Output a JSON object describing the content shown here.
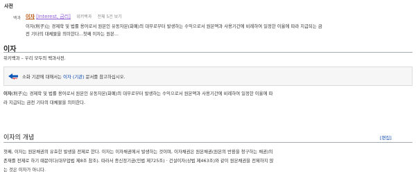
{
  "dictionary_section": {
    "label": "사전",
    "source_label": "백과",
    "result": {
      "term": "이자",
      "subterm": "[Interest, 금리]",
      "source": "위키백과",
      "view_all": "전체 5건 보기",
      "snippet_line1": "이자(利子)는 경제학 및 법률 용어로서 원본인 유동자본(화폐)의 대부로부터 발생하는 수익으로서 원본액과 사용기간에 비례하여 일정한 이율에 따라 지급되는 금",
      "snippet_line2": "전 기타의 대체물을 의미한다...첫째 이자는 원본..."
    }
  },
  "article": {
    "title": "이자",
    "subtitle": "위키백과 – 우리 모두의 백과사전.",
    "notice": {
      "text_before": "소화 기관에 대해서는",
      "link": "이자 (기관)",
      "text_after": "문서를 참고하십시오."
    },
    "intro": {
      "term": "이자",
      "line1": "(利子)는 경제학 및 법률 용어로서 원본인 유동자본(화폐)의 대부로부터 발생하는 수익으로서 원본액과 사용기간에 비례하여 일정한 이율에 따",
      "line2": "라 지급되는 금전 기타의 대체물을 의미한다."
    },
    "section": {
      "heading": "이자의 개념",
      "edit_label": "[편집]",
      "line1": "첫째, 이자는 원본채권의 유효한 발생을 전제로 한다. 이자는 이자채권에서 발생하는 것이며, 이자채권은 원본채권(원본의 반환을 청구하는 채권)의",
      "line2": "존재를 전제로 하기 때문이다(대부업법 제8조 참조). 따라서 종신정기금(민법 제725조) · 건설이자(상법 제463조)와 같이 원본채권을 전제하지 않",
      "line3": "는 것은 이자가 아니다."
    }
  },
  "colors": {
    "link": "#0645ad",
    "term_highlight": "#b54b00",
    "subterm": "#8e5bd6"
  },
  "icons": {
    "notice": "disambiguation-icon"
  }
}
